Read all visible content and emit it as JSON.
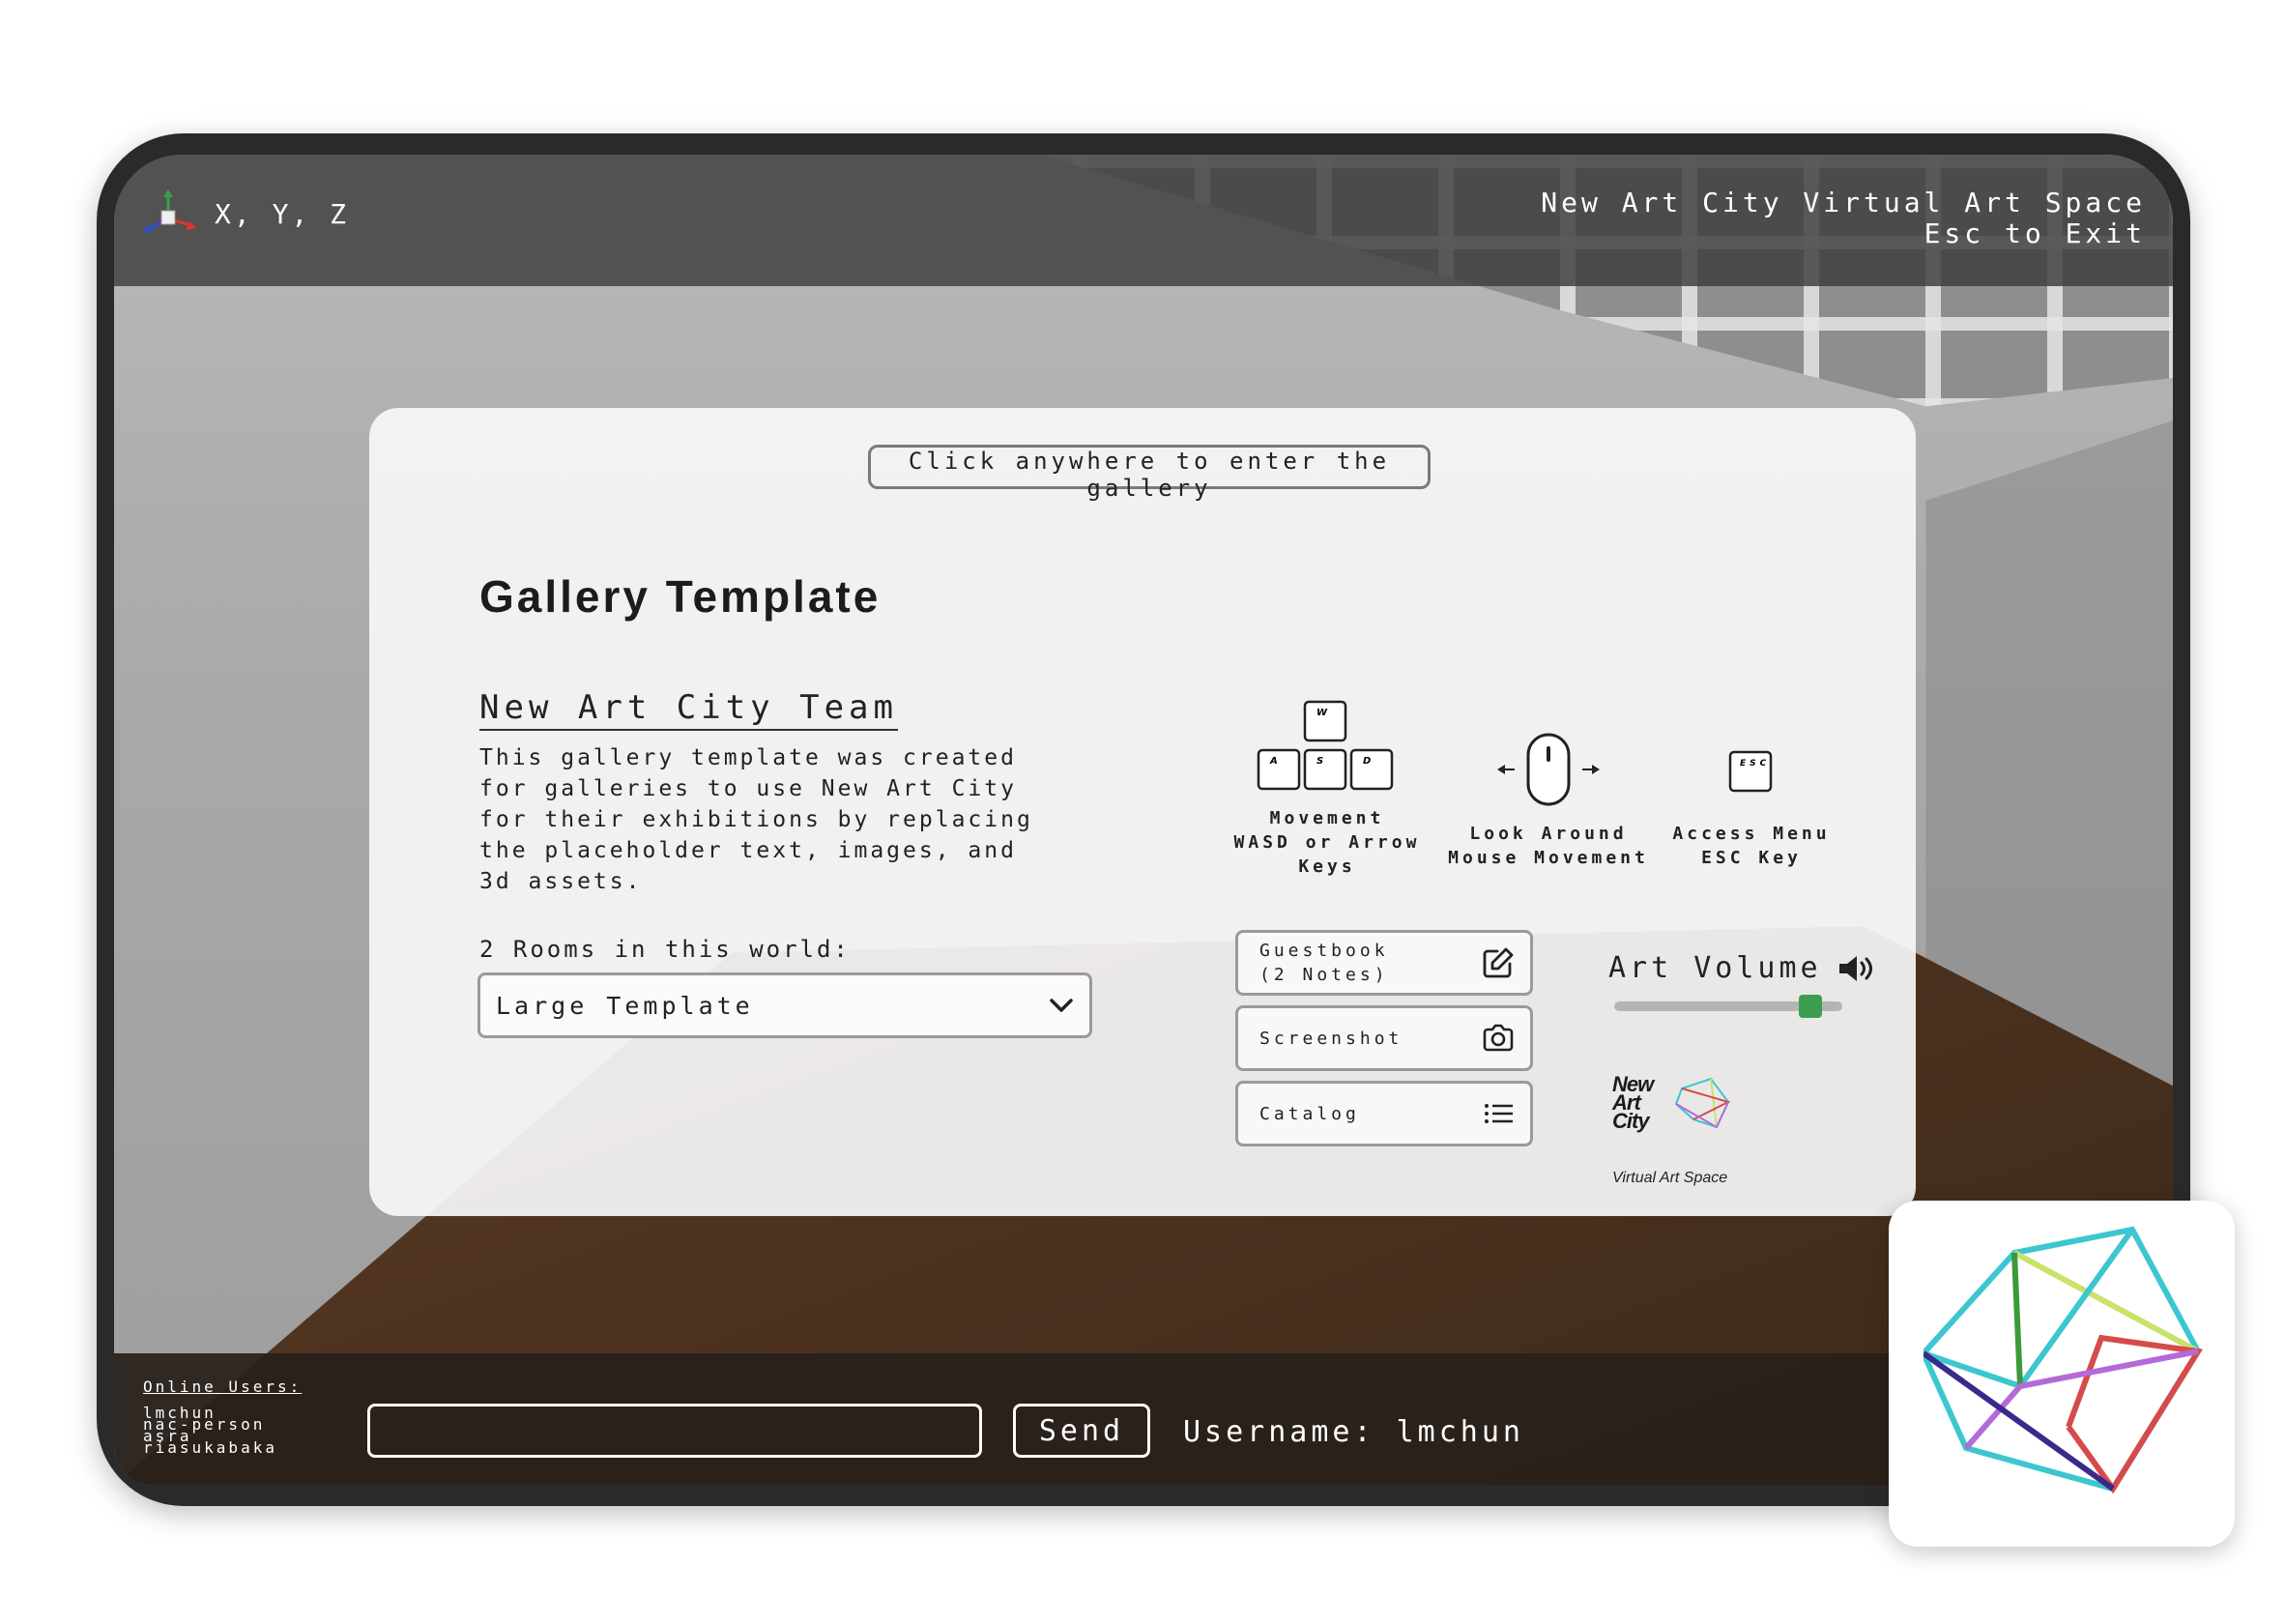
{
  "topbar": {
    "coords_label": "X, Y, Z",
    "app_title": "New Art City Virtual Art Space",
    "exit_hint": "Esc to Exit"
  },
  "card": {
    "enter_prompt": "Click anywhere to enter the gallery",
    "gallery_title": "Gallery Template",
    "author": "New Art City Team",
    "description": "This gallery template was created for galleries to use New Art City for their exhibitions by replacing the placeholder text, images, and 3d assets.",
    "rooms_label": "2 Rooms in this world:",
    "room_selected": "Large Template"
  },
  "controls": {
    "movement": {
      "title": "Movement",
      "keys": "WASD or Arrow Keys",
      "key_w": "W",
      "key_a": "A",
      "key_s": "S",
      "key_d": "D"
    },
    "look": {
      "title": "Look Around",
      "keys": "Mouse Movement"
    },
    "menu": {
      "title": "Access Menu",
      "keys": "ESC Key",
      "key_esc": "ESC"
    }
  },
  "actions": {
    "guestbook_line1": "Guestbook",
    "guestbook_line2": "(2 Notes)",
    "screenshot": "Screenshot",
    "catalog": "Catalog"
  },
  "volume": {
    "label": "Art Volume",
    "level": 0.86,
    "accent": "#3e9e4f"
  },
  "brand": {
    "line1": "New",
    "line2": "Art",
    "line3": "City",
    "tagline": "Virtual Art Space"
  },
  "chat": {
    "online_header": "Online Users:",
    "users": [
      "lmchun",
      "nac-person",
      "asra",
      "riasukabaka"
    ],
    "input_value": "",
    "send_label": "Send",
    "username": "Username: lmchun"
  },
  "icons": {
    "axis": "xyz-axis-icon",
    "guestbook": "edit-icon",
    "screenshot": "camera-icon",
    "catalog": "list-icon",
    "volume": "speaker-icon",
    "mouse": "mouse-icon",
    "dropdown": "chevron-down-icon"
  }
}
